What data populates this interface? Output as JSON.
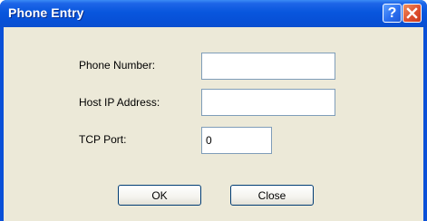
{
  "window": {
    "title": "Phone Entry",
    "help_glyph": "?",
    "help_icon": "help-icon",
    "close_icon": "close-icon"
  },
  "form": {
    "phone_number_label": "Phone Number:",
    "phone_number_value": "",
    "host_ip_label": "Host IP Address:",
    "host_ip_value": "",
    "tcp_port_label": "TCP Port:",
    "tcp_port_value": "0"
  },
  "buttons": {
    "ok_label": "OK",
    "close_label": "Close"
  },
  "colors": {
    "titlebar": "#0856dd",
    "dialog_bg": "#ece9d8",
    "close_button": "#de5030",
    "help_button": "#2a6ef0"
  }
}
